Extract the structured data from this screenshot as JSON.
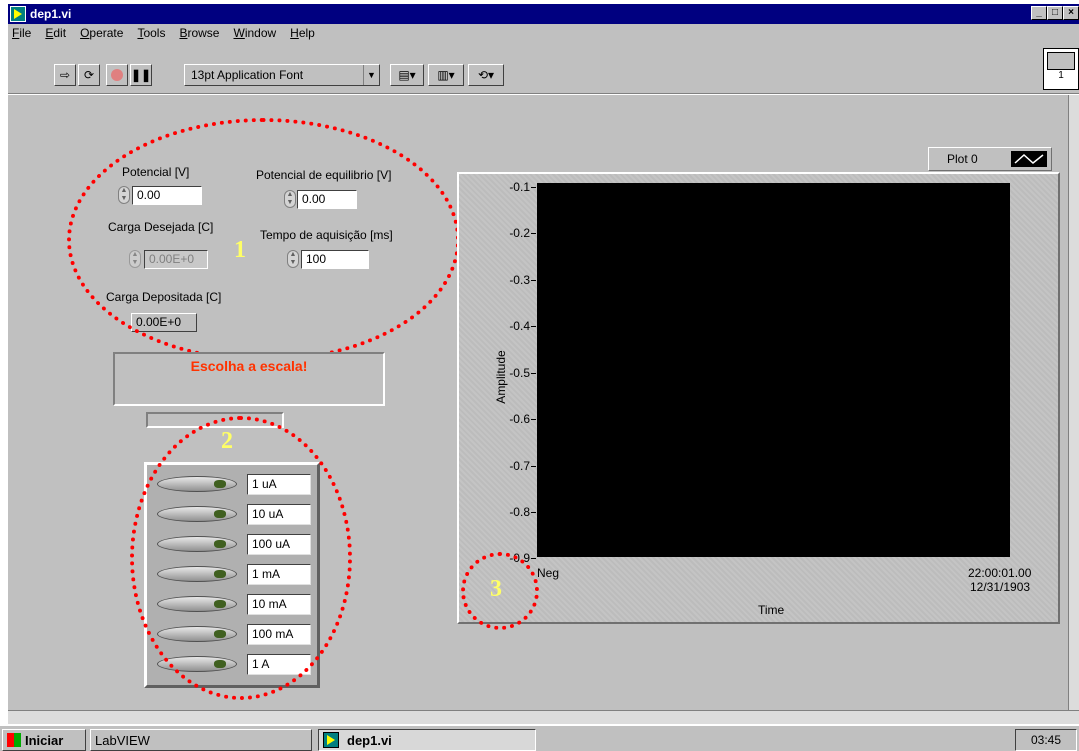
{
  "window": {
    "title": "dep1.vi"
  },
  "menu": [
    "File",
    "Edit",
    "Operate",
    "Tools",
    "Browse",
    "Window",
    "Help"
  ],
  "toolbar": {
    "font": "13pt Application Font",
    "connector_number": "1"
  },
  "controls": {
    "potencial": {
      "label": "Potencial [V]",
      "value": "0.00"
    },
    "potencial_equilibrio": {
      "label": "Potencial de equilibrio [V]",
      "value": "0.00"
    },
    "carga_desejada": {
      "label": "Carga Desejada [C]",
      "value": "0.00E+0"
    },
    "tempo_aquisicao": {
      "label": "Tempo de aquisição [ms]",
      "value": "100"
    },
    "carga_depositada": {
      "label": "Carga Depositada [C]",
      "value": "0.00E+0"
    }
  },
  "message": "Escolha a escala!",
  "scales": [
    "1 uA",
    "10 uA",
    "100 uA",
    "1 mA",
    "10 mA",
    "100 mA",
    "1 A"
  ],
  "annotations": [
    "1",
    "2",
    "3"
  ],
  "graph": {
    "legend": "Plot 0",
    "ylabel": "Amplitude",
    "xlabel": "Time",
    "yticks": [
      "-0.1",
      "-0.2",
      "-0.3",
      "-0.4",
      "-0.5",
      "-0.6",
      "-0.7",
      "-0.8",
      "-0.9"
    ],
    "x_start": "Neg",
    "x_end_time": "22:00:01.00",
    "x_end_date": "12/31/1903"
  },
  "taskbar": {
    "start": "Iniciar",
    "app": "LabVIEW",
    "active": "dep1.vi",
    "clock": "03:45"
  }
}
